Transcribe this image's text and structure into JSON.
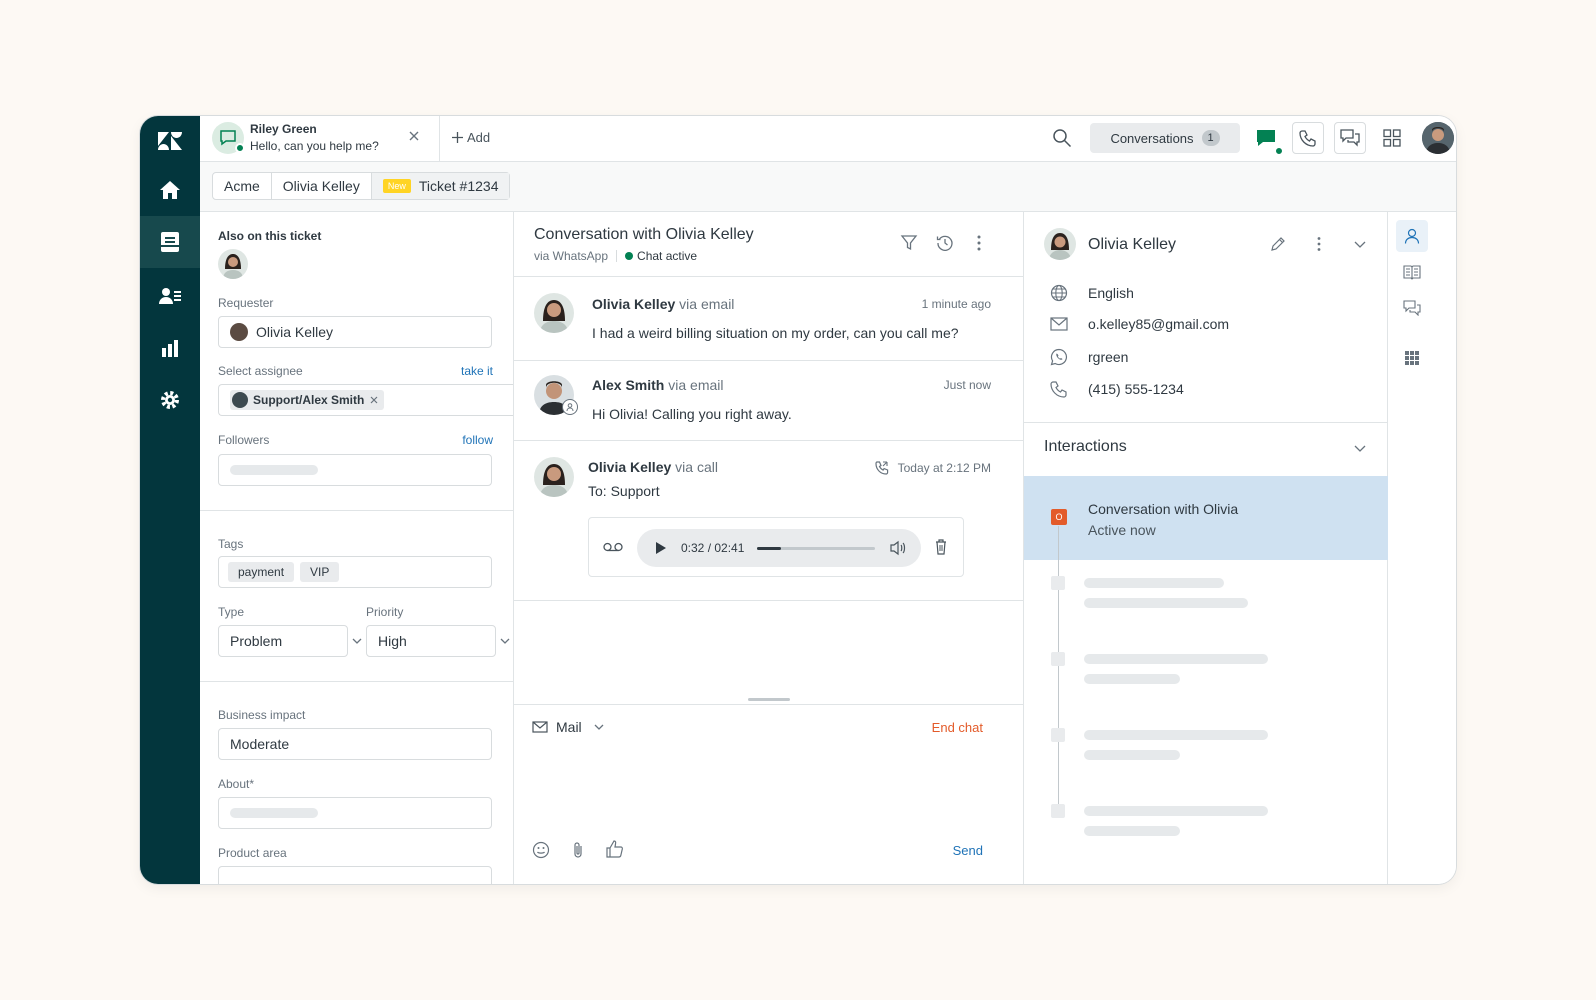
{
  "chat_tab": {
    "name": "Riley Green",
    "message": "Hello, can you help me?"
  },
  "topbar": {
    "add_label": "Add",
    "conversations_label": "Conversations",
    "conversations_count": "1"
  },
  "breadcrumb": {
    "org": "Acme",
    "requester": "Olivia Kelley",
    "status_badge": "New",
    "ticket": "Ticket #1234"
  },
  "left": {
    "also_on_ticket": "Also on this ticket",
    "requester_label": "Requester",
    "requester_value": "Olivia Kelley",
    "assignee_label": "Select assignee",
    "take_it": "take it",
    "assignee_value": "Support/Alex Smith",
    "followers_label": "Followers",
    "follow": "follow",
    "tags_label": "Tags",
    "tags": [
      "payment",
      "VIP"
    ],
    "type_label": "Type",
    "type_value": "Problem",
    "priority_label": "Priority",
    "priority_value": "High",
    "impact_label": "Business impact",
    "impact_value": "Moderate",
    "about_label": "About*",
    "product_label": "Product area"
  },
  "conversation": {
    "title": "Conversation with Olivia Kelley",
    "channel": "via WhatsApp",
    "status": "Chat active",
    "messages": [
      {
        "name": "Olivia Kelley",
        "via": "via email",
        "time": "1 minute ago",
        "text": "I had a weird billing situation on my order, can you call me?"
      },
      {
        "name": "Alex Smith",
        "via": "via email",
        "time": "Just now",
        "text": "Hi Olivia! Calling you right away."
      },
      {
        "name": "Olivia Kelley",
        "via": "via call",
        "time": "Today at 2:12 PM",
        "text": "To: Support"
      }
    ],
    "audio": {
      "time": "0:32 / 02:41",
      "progress": 0.2
    }
  },
  "composer": {
    "channel": "Mail",
    "end_chat": "End chat",
    "send": "Send"
  },
  "customer": {
    "name": "Olivia Kelley",
    "language": "English",
    "email": "o.kelley85@gmail.com",
    "whatsapp": "rgreen",
    "phone": "(415) 555-1234"
  },
  "interactions": {
    "title": "Interactions",
    "active_title": "Conversation with Olivia",
    "active_status": "Active now",
    "active_icon_letter": "O"
  },
  "colors": {
    "nav": "#03363d",
    "accent": "#1f73b7",
    "green": "#038153",
    "active_interaction": "#cfe1f1",
    "end_chat": "#e35b2a",
    "new_badge": "#ffd424"
  }
}
